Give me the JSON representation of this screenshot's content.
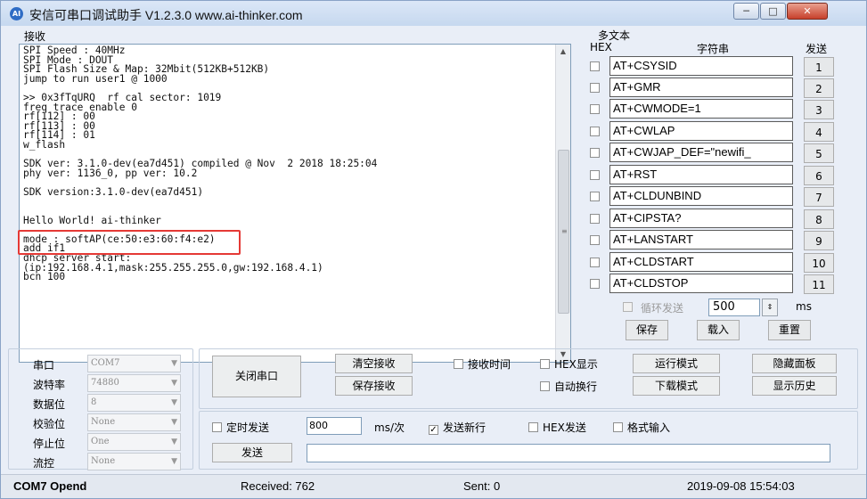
{
  "window": {
    "icon_text": "AI",
    "title": "安信可串口调试助手 V1.2.3.0    www.ai-thinker.com",
    "min": "─",
    "max": "□",
    "close": "✕"
  },
  "receive": {
    "label": "接收",
    "text": "SPI Speed : 40MHz\nSPI Mode : DOUT\nSPI Flash Size & Map: 32Mbit(512KB+512KB)\njump to run user1 @ 1000\n\n>> 0x3fTqURQ  rf cal sector: 1019\nfreq trace enable 0\nrf[112] : 00\nrf[113] : 00\nrf[114] : 01\nw_flash\n\nSDK ver: 3.1.0-dev(ea7d451) compiled @ Nov  2 2018 18:25:04\nphy ver: 1136_0, pp ver: 10.2\n\nSDK version:3.1.0-dev(ea7d451)\n\n\nHello World! ai-thinker\n\nmode : softAP(ce:50:e3:60:f4:e2)\nadd if1\ndhcp server start:\n(ip:192.168.4.1,mask:255.255.255.0,gw:192.168.4.1)\nbcn 100",
    "scroll_up": "▲",
    "scroll_down": "▼",
    "grip": "≡"
  },
  "multi": {
    "label": "多文本",
    "col_hex": "HEX",
    "col_string": "字符串",
    "col_send": "发送",
    "commands": [
      {
        "text": "AT+CSYSID",
        "btn": "1"
      },
      {
        "text": "AT+GMR",
        "btn": "2"
      },
      {
        "text": "AT+CWMODE=1",
        "btn": "3"
      },
      {
        "text": "AT+CWLAP",
        "btn": "4"
      },
      {
        "text": "AT+CWJAP_DEF=\"newifi_",
        "btn": "5"
      },
      {
        "text": "AT+RST",
        "btn": "6"
      },
      {
        "text": "AT+CLDUNBIND",
        "btn": "7"
      },
      {
        "text": "AT+CIPSTA?",
        "btn": "8"
      },
      {
        "text": "AT+LANSTART",
        "btn": "9"
      },
      {
        "text": "AT+CLDSTART",
        "btn": "10"
      },
      {
        "text": "AT+CLDSTOP",
        "btn": "11"
      }
    ],
    "loop_label": "循环发送",
    "loop_ms": "500",
    "ms": "ms",
    "save": "保存",
    "load": "载入",
    "reset": "重置",
    "spin": "⇕"
  },
  "port": {
    "rows": [
      {
        "label": "串口",
        "value": "COM7"
      },
      {
        "label": "波特率",
        "value": "74880"
      },
      {
        "label": "数据位",
        "value": "8"
      },
      {
        "label": "校验位",
        "value": "None"
      },
      {
        "label": "停止位",
        "value": "One"
      },
      {
        "label": "流控",
        "value": "None"
      }
    ],
    "arrow": "▼"
  },
  "controls": {
    "close_port": "关闭串口",
    "clear_recv": "清空接收",
    "save_recv": "保存接收",
    "recv_time": "接收时间",
    "hex_display": "HEX显示",
    "run_mode": "运行模式",
    "hide_panel": "隐藏面板",
    "auto_newline": "自动换行",
    "download_mode": "下载模式",
    "show_history": "显示历史"
  },
  "send": {
    "timed_send": "定时发送",
    "interval": "800",
    "unit": "ms/次",
    "send_newline": "发送新行",
    "hex_send": "HEX发送",
    "format_input": "格式输入",
    "send_btn": "发送",
    "check": "✓"
  },
  "status": {
    "port": "COM7 Opend",
    "received": "Received: 762",
    "sent": "Sent: 0",
    "time": "2019-09-08 15:54:03"
  }
}
